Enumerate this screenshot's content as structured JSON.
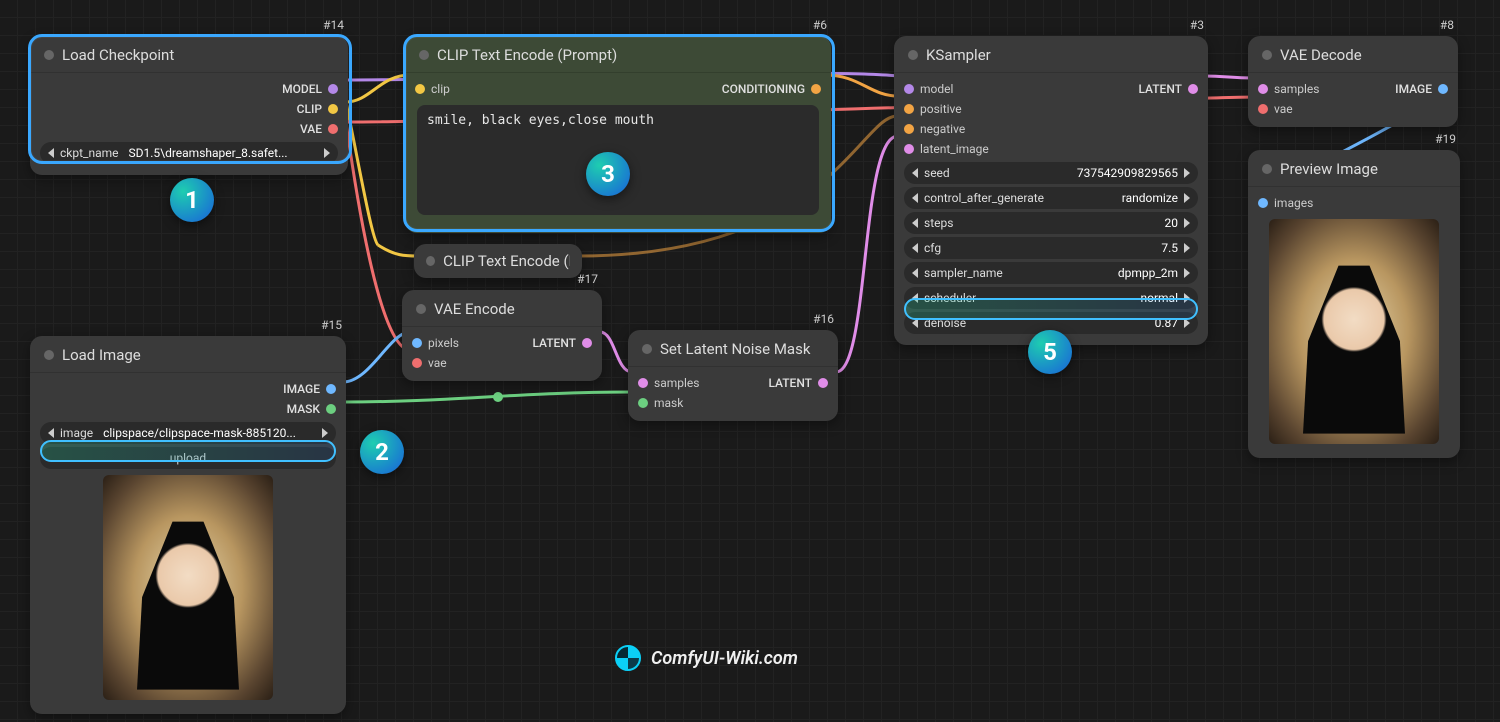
{
  "watermark": "ComfyUI-Wiki.com",
  "nodes": {
    "loadCheckpoint": {
      "tag": "#14",
      "title": "Load Checkpoint",
      "outputs": {
        "model": "MODEL",
        "clip": "CLIP",
        "vae": "VAE"
      },
      "param_ckpt_label": "ckpt_name",
      "param_ckpt_value": "SD1.5\\dreamshaper_8.safet..."
    },
    "clipPos": {
      "tag": "#6",
      "title": "CLIP Text Encode (Prompt)",
      "input_clip": "clip",
      "output": "CONDITIONING",
      "text": "smile, black eyes,close mouth"
    },
    "clipNeg": {
      "tag": "",
      "title": "CLIP Text Encode (Pr"
    },
    "vaeEncode": {
      "tag": "#17",
      "title": "VAE Encode",
      "input_pixels": "pixels",
      "input_vae": "vae",
      "output": "LATENT"
    },
    "loadImage": {
      "tag": "#15",
      "title": "Load Image",
      "output_image": "IMAGE",
      "output_mask": "MASK",
      "param_image_label": "image",
      "param_image_value": "clipspace/clipspace-mask-885120...",
      "upload_btn": "upload"
    },
    "setLatentMask": {
      "tag": "#16",
      "title": "Set Latent Noise Mask",
      "input_samples": "samples",
      "input_mask": "mask",
      "output": "LATENT"
    },
    "ksampler": {
      "tag": "#3",
      "title": "KSampler",
      "inputs": {
        "model": "model",
        "positive": "positive",
        "negative": "negative",
        "latent": "latent_image"
      },
      "output": "LATENT",
      "params": {
        "seed": "737542909829565",
        "control_after_generate": "randomize",
        "steps": "20",
        "cfg": "7.5",
        "sampler_name": "dpmpp_2m",
        "scheduler": "normal",
        "denoise": "0.87"
      }
    },
    "vaeDecode": {
      "tag": "#8",
      "title": "VAE Decode",
      "input_samples": "samples",
      "input_vae": "vae",
      "output": "IMAGE"
    },
    "preview": {
      "tag": "#19",
      "title": "Preview Image",
      "input_images": "images"
    }
  },
  "labels": {
    "seed": "seed",
    "control_after_generate": "control_after_generate",
    "steps": "steps",
    "cfg": "cfg",
    "sampler_name": "sampler_name",
    "scheduler": "scheduler",
    "denoise": "denoise"
  },
  "callouts": {
    "c1": "1",
    "c2": "2",
    "c3": "3",
    "c5": "5"
  }
}
